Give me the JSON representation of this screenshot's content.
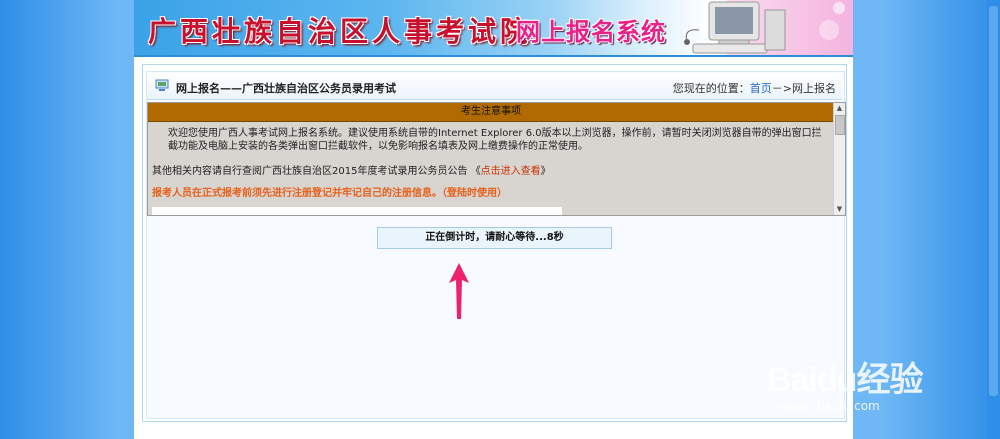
{
  "banner": {
    "org_title": "广西壮族自治区人事考试院",
    "system_title": "网上报名系统"
  },
  "titlebar": {
    "title": "网上报名——广西壮族自治区公务员录用考试",
    "location_prefix": "您现在的位置：",
    "location_home": "首页",
    "location_sep": "－>",
    "location_current": "网上报名"
  },
  "notice": {
    "header": "考生注意事项",
    "para1": "欢迎您使用广西人事考试网上报名系统。建议使用系统自带的Internet Explorer 6.0版本以上浏览器，操作前，请暂时关闭浏览器自带的弹出窗口拦截功能及电脑上安装的各类弹出窗口拦截软件，以免影响报名填表及网上缴费操作的正常使用。",
    "para2_prefix": "其他相关内容请自行查阅广西壮族自治区2015年度考试录用公务员公告 《",
    "para2_link": "点击进入查看",
    "para2_suffix": "》",
    "para3": "报考人员在正式报考前须先进行注册登记并牢记自己的注册信息。（登陆时使用）"
  },
  "countdown": {
    "text": "正在倒计时，请耐心等待...8秒"
  },
  "watermark": {
    "brand": "Baidu经验",
    "url": "jingyan.baidu.com"
  },
  "colors": {
    "notice_header_bg": "#b06a00",
    "notice_body_bg": "#d8d4d0",
    "warning_text": "#e8601a",
    "link": "#2266cc",
    "arrow": "#f0206e",
    "banner_red": "#c8102e",
    "banner_pink": "#e8208a"
  },
  "icons": {
    "title_icon": "computer-icon",
    "banner_image": "desktop-computer-icon",
    "arrow": "arrow-up-icon"
  }
}
